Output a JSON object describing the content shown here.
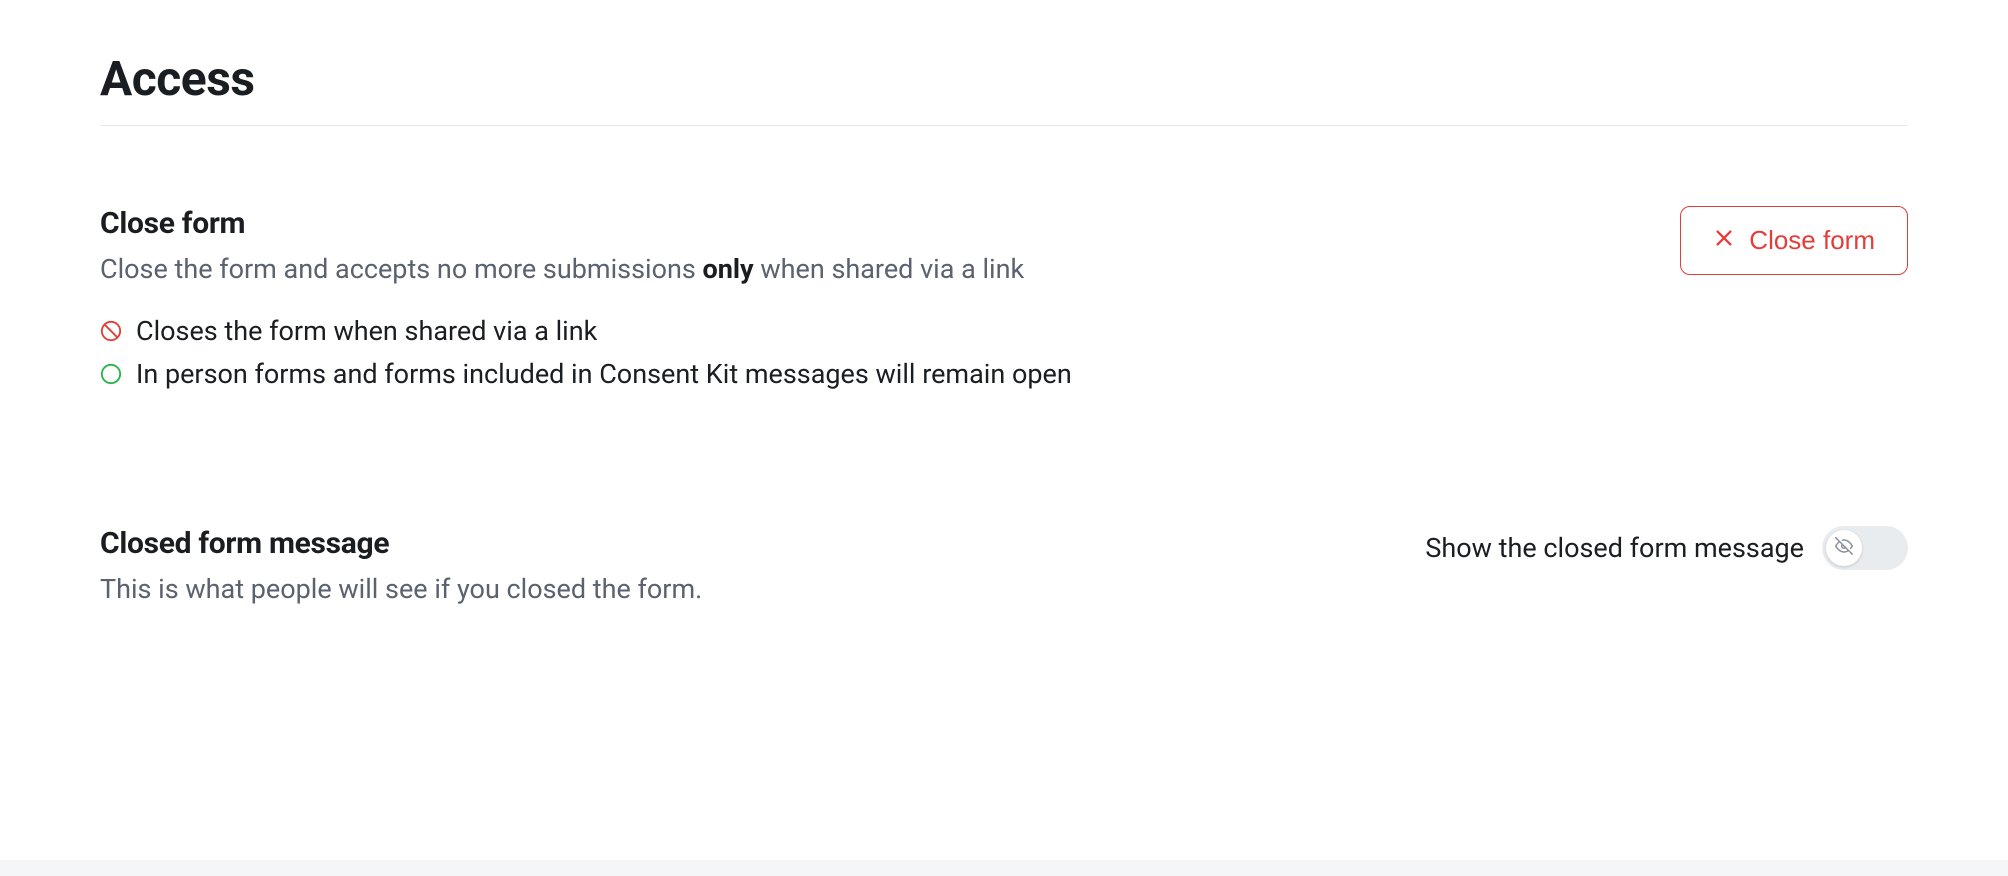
{
  "page": {
    "title": "Access"
  },
  "sections": {
    "close_form": {
      "heading": "Close form",
      "desc_pre": "Close the form and accepts no more submissions ",
      "desc_strong": "only",
      "desc_post": " when shared via a link",
      "bullets": [
        {
          "icon": "no-entry-icon",
          "text": "Closes the form when shared via a link"
        },
        {
          "icon": "circle-open-icon",
          "text": "In person forms and forms included in Consent Kit messages will remain open"
        }
      ],
      "button_label": "Close form"
    },
    "closed_message": {
      "heading": "Closed form message",
      "desc": "This is what people will see if you closed the form.",
      "toggle_label": "Show the closed form message",
      "toggle_on": false
    }
  },
  "colors": {
    "danger": "#e33e38",
    "success": "#2bb34a",
    "text": "#1a1d21",
    "muted": "#5a6270"
  }
}
